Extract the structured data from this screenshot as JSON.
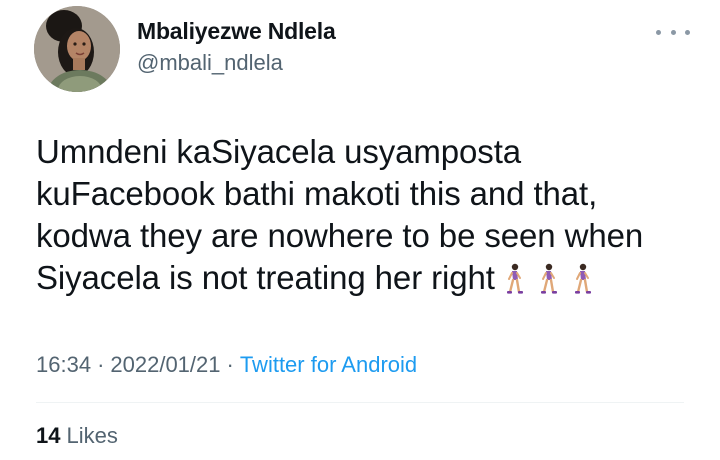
{
  "author": {
    "display_name": "Mbaliyezwe Ndlela",
    "handle": "@mbali_ndlela",
    "avatar_icon": "profile-photo"
  },
  "more_icon": "more-options-icon",
  "tweet": {
    "lines": [
      "Umndeni kaSiyacela usyamposta",
      "kuFacebook bathi makoti this and that,",
      "kodwa they are nowhere to be seen when",
      "Siyacela is not treating her right"
    ],
    "trailing_emoji": [
      "woman-walking-emoji",
      "woman-walking-emoji",
      "woman-walking-emoji"
    ]
  },
  "meta": {
    "time": "16:34",
    "separator": "·",
    "date": "2022/01/21",
    "source": "Twitter for Android"
  },
  "stats": {
    "likes_count": "14",
    "likes_label": "Likes"
  },
  "colors": {
    "text": "#0f1419",
    "secondary": "#536471",
    "link": "#1d9bf0",
    "divider": "#eff3f4"
  }
}
